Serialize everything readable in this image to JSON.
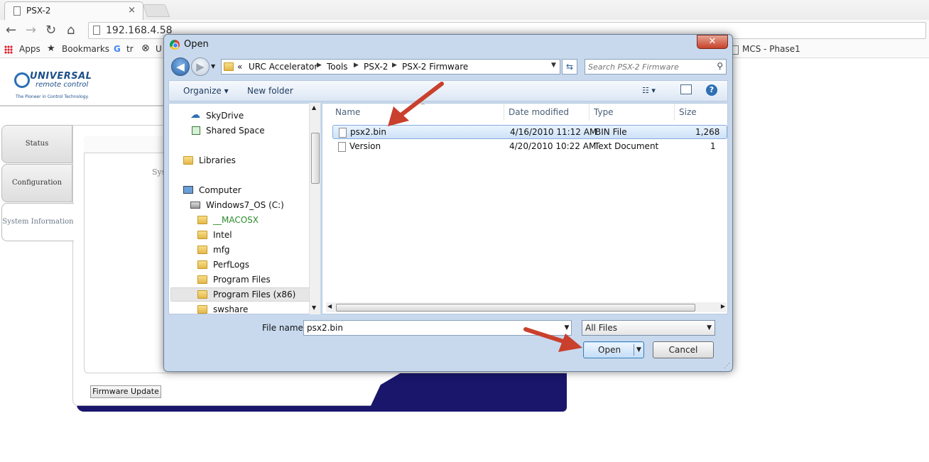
{
  "browser": {
    "tab_title": "PSX-2",
    "tab_close": "×",
    "url": "192.168.4.58",
    "nav": {
      "back": "←",
      "forward": "→",
      "reload": "↻",
      "home": "⌂"
    },
    "bookmarks": [
      {
        "label": "Apps",
        "icon": "apps-grid-icon"
      },
      {
        "label": "Bookmarks",
        "icon": "star-icon"
      },
      {
        "label": "tr",
        "icon": "google-icon"
      },
      {
        "label": "U",
        "icon": "urc-icon"
      },
      {
        "label": "MCS - Phase1",
        "icon": "page-icon"
      }
    ]
  },
  "webpage": {
    "logo": {
      "brand": "UNIVERSAL",
      "brand2": "remote control",
      "tagline": "The Pioneer in Control Technology."
    },
    "tabs": [
      {
        "label": "Status",
        "active": false
      },
      {
        "label": "Configuration",
        "active": false
      },
      {
        "label": "System Information",
        "active": true
      }
    ],
    "partial_label": "Sys",
    "firmware_button": "Firmware Update",
    "colors": {
      "footer_band": "#19166b"
    }
  },
  "dialog": {
    "title": "Open",
    "close": "✕",
    "breadcrumb": {
      "prefix": "«",
      "items": [
        "URC Accelerator",
        "Tools",
        "PSX-2",
        "PSX-2 Firmware"
      ]
    },
    "search_placeholder": "Search PSX-2 Firmware",
    "commands": {
      "organize": "Organize ▾",
      "new_folder": "New folder"
    },
    "nav_items": [
      {
        "label": "SkyDrive",
        "icon": "cloud-icon",
        "indent": 1
      },
      {
        "label": "Shared Space",
        "icon": "shared-icon",
        "indent": 1
      },
      {
        "label": "Libraries",
        "icon": "library-icon",
        "indent": 0
      },
      {
        "label": "Computer",
        "icon": "computer-icon",
        "indent": 0
      },
      {
        "label": "Windows7_OS (C:)",
        "icon": "drive-icon",
        "indent": 1
      },
      {
        "label": "__MACOSX",
        "icon": "folder-icon",
        "indent": 2
      },
      {
        "label": "Intel",
        "icon": "folder-icon",
        "indent": 2
      },
      {
        "label": "mfg",
        "icon": "folder-icon",
        "indent": 2
      },
      {
        "label": "PerfLogs",
        "icon": "folder-icon",
        "indent": 2
      },
      {
        "label": "Program Files",
        "icon": "folder-icon",
        "indent": 2
      },
      {
        "label": "Program Files (x86)",
        "icon": "folder-icon",
        "indent": 2
      },
      {
        "label": "swshare",
        "icon": "folder-icon",
        "indent": 2
      }
    ],
    "columns": [
      "Name",
      "Date modified",
      "Type",
      "Size"
    ],
    "files": [
      {
        "name": "psx2.bin",
        "date": "4/16/2010 11:12 AM",
        "type": "BIN File",
        "size": "1,268",
        "selected": true
      },
      {
        "name": "Version",
        "date": "4/20/2010 10:22 AM",
        "type": "Text Document",
        "size": "1",
        "selected": false
      }
    ],
    "file_name_label": "File name:",
    "file_name_value": "psx2.bin",
    "filter": "All Files",
    "open_button": "Open",
    "cancel_button": "Cancel",
    "colors": {
      "macosx_text": "#2b8a2b",
      "annotation_arrow": "#c9402c"
    }
  }
}
